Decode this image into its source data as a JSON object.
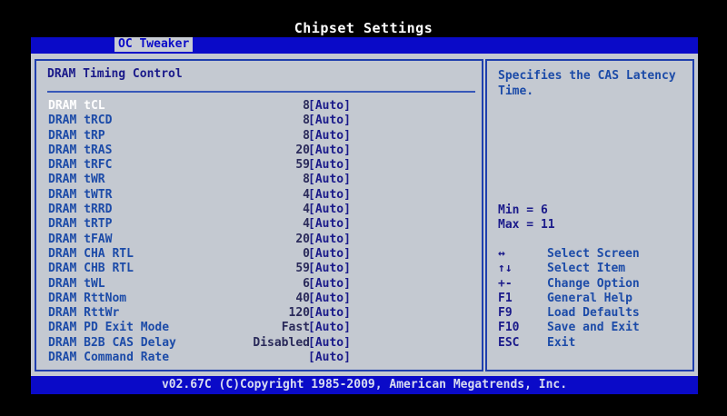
{
  "window": {
    "title": "Chipset Settings"
  },
  "tabs": [
    {
      "label": "OC Tweaker",
      "active": true
    }
  ],
  "section": {
    "title": "DRAM Timing Control"
  },
  "settings": [
    {
      "name": "DRAM tCL",
      "value": "8",
      "option": "[Auto]",
      "selected": true
    },
    {
      "name": "DRAM tRCD",
      "value": "8",
      "option": "[Auto]"
    },
    {
      "name": "DRAM tRP",
      "value": "8",
      "option": "[Auto]"
    },
    {
      "name": "DRAM tRAS",
      "value": "20",
      "option": "[Auto]"
    },
    {
      "name": "DRAM tRFC",
      "value": "59",
      "option": "[Auto]"
    },
    {
      "name": "DRAM tWR",
      "value": "8",
      "option": "[Auto]"
    },
    {
      "name": "DRAM tWTR",
      "value": "4",
      "option": "[Auto]"
    },
    {
      "name": "DRAM tRRD",
      "value": "4",
      "option": "[Auto]"
    },
    {
      "name": "DRAM tRTP",
      "value": "4",
      "option": "[Auto]"
    },
    {
      "name": "DRAM tFAW",
      "value": "20",
      "option": "[Auto]"
    },
    {
      "name": "DRAM CHA RTL",
      "value": "0",
      "option": "[Auto]"
    },
    {
      "name": "DRAM CHB RTL",
      "value": "59",
      "option": "[Auto]"
    },
    {
      "name": "DRAM tWL",
      "value": "6",
      "option": "[Auto]"
    },
    {
      "name": "DRAM RttNom",
      "value": "40",
      "option": "[Auto]"
    },
    {
      "name": "DRAM RttWr",
      "value": "120",
      "option": "[Auto]"
    },
    {
      "name": "DRAM PD Exit Mode",
      "value": "Fast",
      "option": "[Auto]"
    },
    {
      "name": "DRAM B2B CAS Delay",
      "value": "Disabled",
      "option": "[Auto]"
    },
    {
      "name": "DRAM Command Rate",
      "value": "",
      "option": "[Auto]"
    }
  ],
  "help": {
    "text": "Specifies the CAS Latency Time.",
    "min": "Min = 6",
    "max": "Max = 11"
  },
  "keys": [
    {
      "key": "↔",
      "desc": "Select Screen"
    },
    {
      "key": "↑↓",
      "desc": "Select Item"
    },
    {
      "key": "+-",
      "desc": "Change Option"
    },
    {
      "key": "F1",
      "desc": "General Help"
    },
    {
      "key": "F9",
      "desc": "Load Defaults"
    },
    {
      "key": "F10",
      "desc": "Save and Exit"
    },
    {
      "key": "ESC",
      "desc": "Exit"
    }
  ],
  "footer": {
    "text": "v02.67C (C)Copyright 1985-2009, American Megatrends, Inc."
  },
  "colors": {
    "background": "#000000",
    "bar_blue": "#0a0ac8",
    "panel_gray": "#c4c9d1",
    "text_blue": "#1c4ba8"
  }
}
